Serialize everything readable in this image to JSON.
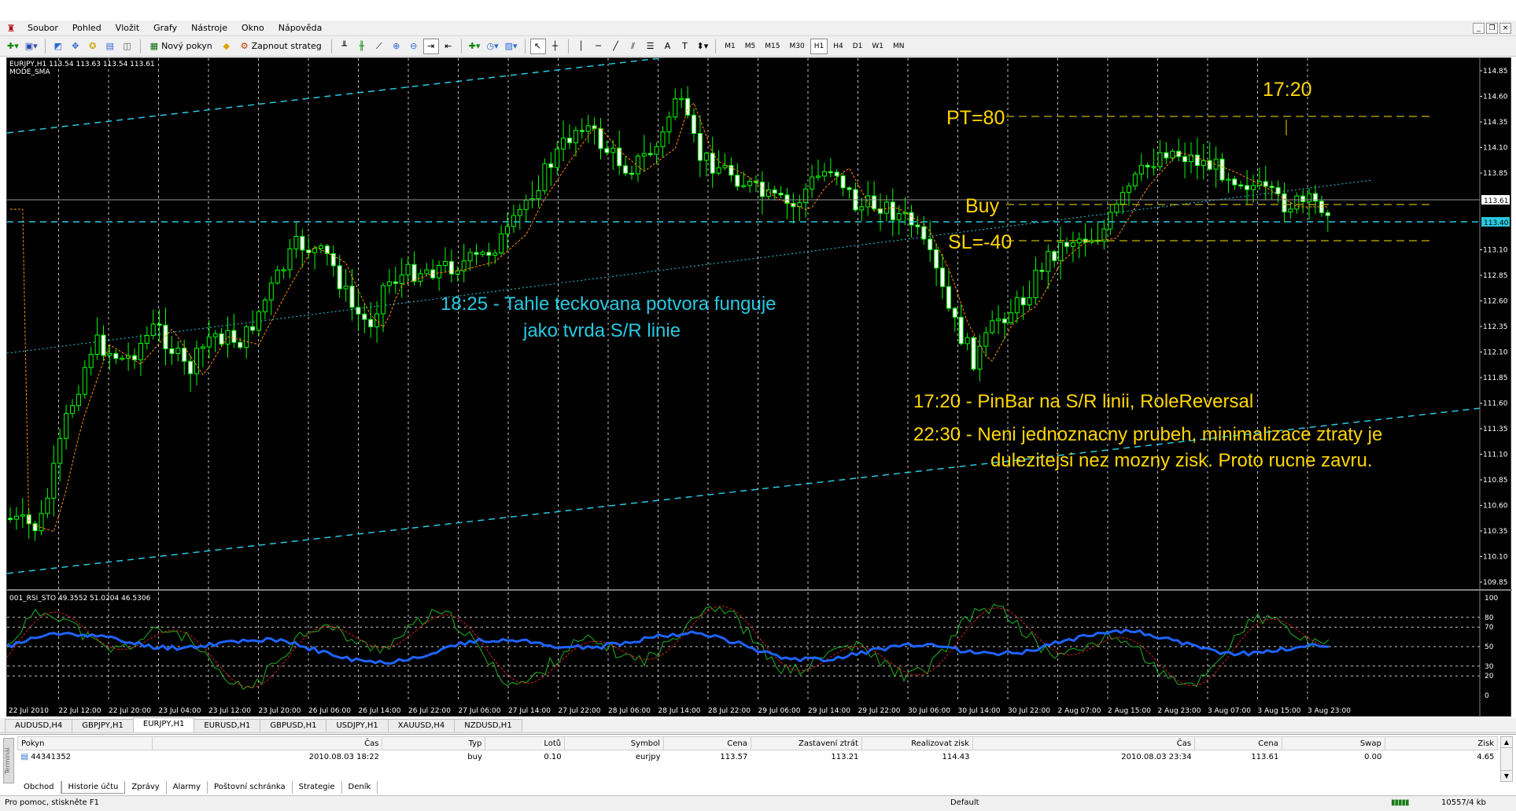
{
  "menu": {
    "items": [
      "Soubor",
      "Pohled",
      "Vložit",
      "Grafy",
      "Nástroje",
      "Okno",
      "Nápověda"
    ]
  },
  "toolbar": {
    "new_order_label": "Nový pokyn",
    "autotrading_label": "Zapnout strateg",
    "timeframes": [
      "M1",
      "M5",
      "M15",
      "M30",
      "H1",
      "H4",
      "D1",
      "W1",
      "MN"
    ],
    "active_timeframe": "H1"
  },
  "chart": {
    "header_line1": "EURJPY,H1  113.54 113.63 113.54 113.61",
    "header_line2": "MODE_SMA",
    "current_price": "113.61",
    "line_price": "113.40",
    "price_levels": [
      "114.85",
      "114.60",
      "114.35",
      "114.10",
      "113.85",
      "113.61",
      "113.40",
      "113.10",
      "112.85",
      "112.60",
      "112.35",
      "112.10",
      "111.85",
      "111.60",
      "111.35",
      "111.10",
      "110.85",
      "110.60",
      "110.35",
      "110.10",
      "109.85"
    ],
    "time_labels": [
      "22 Jul 2010",
      "22 Jul 12:00",
      "22 Jul 20:00",
      "23 Jul 04:00",
      "23 Jul 12:00",
      "23 Jul 20:00",
      "26 Jul 06:00",
      "26 Jul 14:00",
      "26 Jul 22:00",
      "27 Jul 06:00",
      "27 Jul 14:00",
      "27 Jul 22:00",
      "28 Jul 06:00",
      "28 Jul 14:00",
      "28 Jul 22:00",
      "29 Jul 06:00",
      "29 Jul 14:00",
      "29 Jul 22:00",
      "30 Jul 06:00",
      "30 Jul 14:00",
      "30 Jul 22:00",
      "2 Aug 07:00",
      "2 Aug 15:00",
      "2 Aug 23:00",
      "3 Aug 07:00",
      "3 Aug 15:00",
      "3 Aug 23:00"
    ],
    "annotations": {
      "time_top": "17:20",
      "pt": "PT=80",
      "buy": "Buy",
      "sl": "SL=-40",
      "note_sr_1": "18:25 - Tahle teckovana potvora funguje",
      "note_sr_2": "jako tvrda S/R linie",
      "note_pinbar": "17:20 - PinBar na S/R linii, RoleReversal",
      "note_close_1": "22:30 - Neni jednoznacny prubeh, minimalizace ztraty je",
      "note_close_2": "dulezitejsi nez mozny zisk. Proto rucne zavru."
    },
    "colors": {
      "candle": "#00ff00",
      "ma": "#ff8c00",
      "trendline": "#00bcd4",
      "annotation_yellow": "#ffd700",
      "annotation_cyan": "#29c8e0",
      "rsi_line": "#1e64ff"
    }
  },
  "indicator": {
    "header": "001_RSI_STO 49.3552 51.0204 46.5306",
    "levels": [
      "100",
      "80",
      "70",
      "50",
      "30",
      "20",
      "0"
    ]
  },
  "symbol_tabs": [
    "AUDUSD,H4",
    "GBPJPY,H1",
    "EURJPY,H1",
    "EURUSD,H1",
    "GBPUSD,H1",
    "USDJPY,H1",
    "XAUUSD,H4",
    "NZDUSD,H1"
  ],
  "active_symbol_tab": "EURJPY,H1",
  "terminal": {
    "side_label": "Terminál",
    "columns": [
      "Pokyn",
      "Čas",
      "Typ",
      "Lotů",
      "Symbol",
      "Cena",
      "Zastavení ztrát",
      "Realizovat zisk",
      "Čas",
      "Cena",
      "Swap",
      "Zisk"
    ],
    "rows": [
      [
        "44341352",
        "2010.08.03 18:22",
        "buy",
        "0.10",
        "eurjpy",
        "113.57",
        "113.21",
        "114.43",
        "2010.08.03 23:34",
        "113.61",
        "0.00",
        "4.65"
      ]
    ],
    "tabs": [
      "Obchod",
      "Historie účtu",
      "Zprávy",
      "Alarmy",
      "Poštovní schránka",
      "Strategie",
      "Deník"
    ],
    "active_tab": "Historie účtu"
  },
  "status": {
    "help": "Pro pomoc, stiskněte F1",
    "profile": "Default",
    "traffic": "10557/4 kb"
  }
}
